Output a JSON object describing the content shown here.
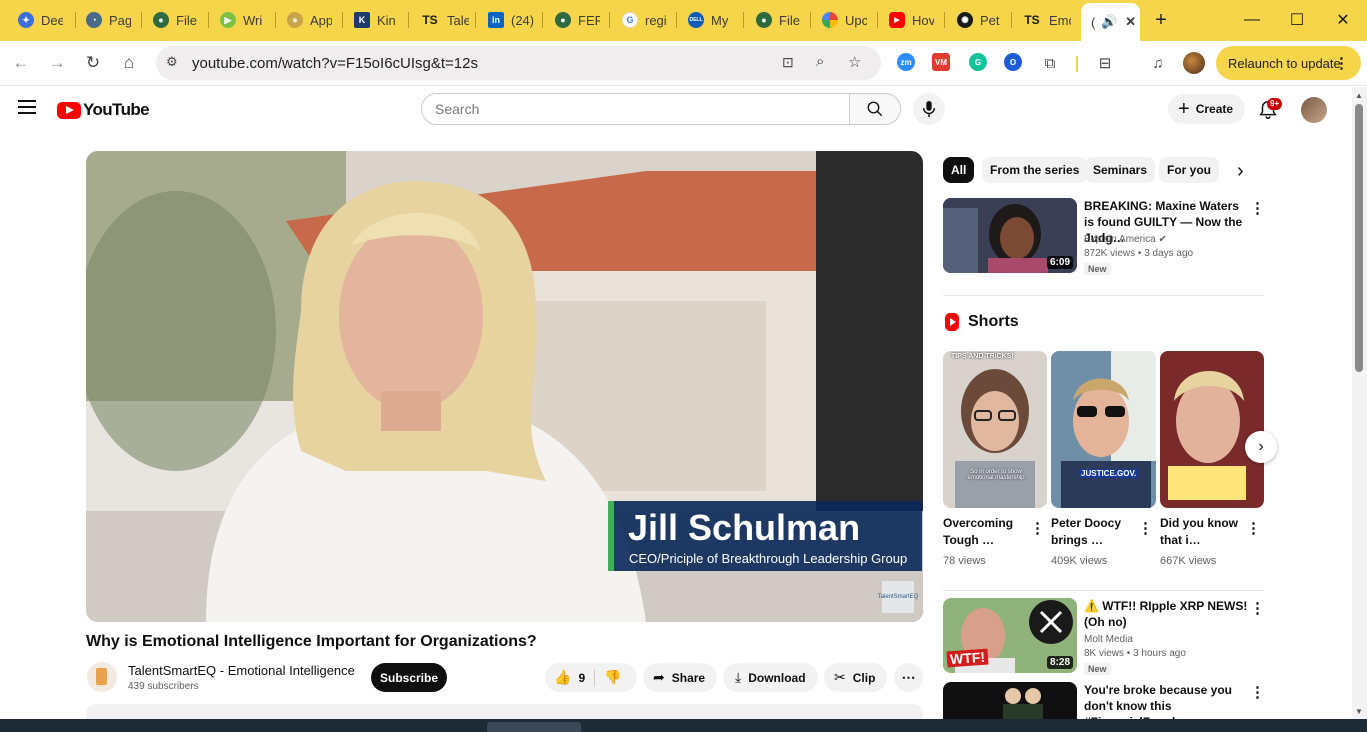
{
  "browser": {
    "tabs": [
      {
        "label": "Dee",
        "favicon_color": "#3d6fd8",
        "icon": "compass-icon"
      },
      {
        "label": "Pag",
        "favicon_color": "#4a6a8a",
        "icon": "speedometer-icon"
      },
      {
        "label": "File",
        "favicon_color": "#2d6a3e",
        "icon": "seal-icon"
      },
      {
        "label": "Wri",
        "favicon_color": "#7cc142",
        "icon": "play-icon"
      },
      {
        "label": "App",
        "favicon_color": "#c9a24a",
        "icon": "seal-icon"
      },
      {
        "label": "Kin",
        "favicon_color": "#1c3b6b",
        "icon": "k-icon"
      },
      {
        "label": "Tale",
        "favicon_color": "#1a1a1a",
        "icon": "ts-icon"
      },
      {
        "label": "(24)",
        "favicon_color": "#0a66c2",
        "icon": "linkedin-icon"
      },
      {
        "label": "FER",
        "favicon_color": "#2d6a3e",
        "icon": "seal-icon"
      },
      {
        "label": "regi",
        "favicon_color": "#ffffff",
        "icon": "google-icon"
      },
      {
        "label": "My",
        "favicon_color": "#0a5eb8",
        "icon": "dell-icon"
      },
      {
        "label": "File",
        "favicon_color": "#2d6a3e",
        "icon": "seal-icon"
      },
      {
        "label": "Upc",
        "favicon_color": "#e8a33c",
        "icon": "palette-icon"
      },
      {
        "label": "Hov",
        "favicon_color": "#ff0000",
        "icon": "youtube-icon"
      },
      {
        "label": "Pet",
        "favicon_color": "#1a1a1a",
        "icon": "openai-icon"
      },
      {
        "label": "Emc",
        "favicon_color": "#1a1a1a",
        "icon": "ts-icon"
      },
      {
        "label": "(",
        "favicon_color": "#ffffff",
        "icon": "speaker-icon",
        "active": true
      }
    ],
    "ts_text": "TS",
    "in_text": "in",
    "new_tab": "+",
    "window": {
      "minimize": "—",
      "maximize": "☐",
      "close": "✕"
    },
    "url": "youtube.com/watch?v=F15oI6cUIsg&t=12s",
    "relaunch_label": "Relaunch to update",
    "extensions": [
      {
        "name": "zoom-ext-icon",
        "color": "#2d8cff",
        "text": "zm"
      },
      {
        "name": "vimeo-ext-icon",
        "color": "#e03c31",
        "text": "VM"
      },
      {
        "name": "grammarly-ext-icon",
        "color": "#15c39a",
        "text": "G"
      },
      {
        "name": "loom-ext-icon",
        "color": "#1f5bd8",
        "text": "O"
      }
    ]
  },
  "youtube": {
    "logo_text": "YouTube",
    "search_placeholder": "Search",
    "create_label": "Create",
    "notifications_badge": "9+"
  },
  "video": {
    "title": "Why is Emotional Intelligence Important for Organizations?",
    "lower_third_name": "Jill Schulman",
    "lower_third_title": "CEO/Priciple of Breakthrough Leadership Group",
    "watermark": "TalentSmartEQ",
    "channel_name": "TalentSmartEQ - Emotional Intelligence",
    "subscribers": "439 subscribers",
    "subscribe_label": "Subscribe",
    "likes": "9",
    "share_label": "Share",
    "download_label": "Download",
    "clip_label": "Clip"
  },
  "sidebar": {
    "chips": [
      "All",
      "From the series",
      "Seminars",
      "For you"
    ],
    "recommended": [
      {
        "title": "BREAKING: Maxine Waters is found GUILTY — Now the Judg…",
        "channel": "Explain America",
        "verified": true,
        "meta": "872K views • 3 days ago",
        "badge": "New",
        "duration": "6:09"
      },
      {
        "title": "⚠️ WTF!! RIpple XRP NEWS! (Oh no)",
        "channel": "Molt Media",
        "verified": false,
        "meta": "8K views • 3 hours ago",
        "badge": "New",
        "duration": "8:28",
        "thumb_text": "WTF!"
      },
      {
        "title": "You're broke because you don't know this #FinancialFreedom…"
      }
    ],
    "shorts_heading": "Shorts",
    "shorts": [
      {
        "title": "Overcoming Tough …",
        "views": "78 views",
        "overlay": "TIPS AND TRICKS!",
        "caption": "So in order to show emotional mastership"
      },
      {
        "title": "Peter Doocy brings …",
        "views": "409K views",
        "overlay": "JUSTICE.GOV."
      },
      {
        "title": "Did you know that i…",
        "views": "667K views"
      }
    ]
  }
}
